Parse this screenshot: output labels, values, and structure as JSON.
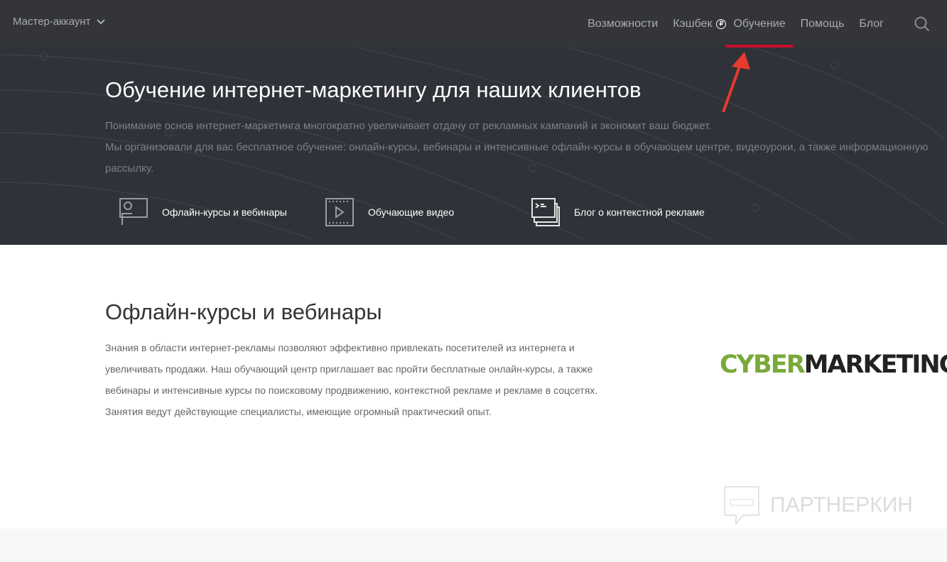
{
  "header": {
    "account": "Мастер-аккаунт",
    "nav": [
      "Возможности",
      "Кэшбек",
      "Обучение",
      "Помощь",
      "Блог"
    ],
    "active": "Обучение",
    "cashback_icon": "₽"
  },
  "hero": {
    "title": "Обучение интернет-маркетингу для наших клиентов",
    "line1": "Понимание основ интернет-маркетинга многократно увеличивает отдачу от рекламных кампаний и экономит ваш бюджет.",
    "line2": "Мы организовали для вас бесплатное обучение: онлайн-курсы, вебинары и интенсивные офлайн-курсы в обучающем центре, видеоуроки, а также информационную рассылку.",
    "features": [
      "Офлайн-курсы и вебинары",
      "Обучающие видео",
      "Блог о контекстной рекламе"
    ]
  },
  "section": {
    "title": "Офлайн-курсы и вебинары",
    "text": "Знания в области интернет-рекламы позволяют эффективно привлекать посетителей из интернета и увеличивать продажи. Наш обучающий центр приглашает вас пройти бесплатные онлайн-курсы, а также вебинары и интенсивные курсы по поисковому продвижению, контекстной рекламе и рекламе в соцсетях. Занятия ведут действующие специалисты, имеющие огромный практический опыт.",
    "logo_green": "CYBER",
    "logo_dark": "MARKETING"
  },
  "watermark": "ПАРТНЕРКИН",
  "colors": {
    "accent": "#c8102e",
    "logo_green": "#7aa83a"
  }
}
